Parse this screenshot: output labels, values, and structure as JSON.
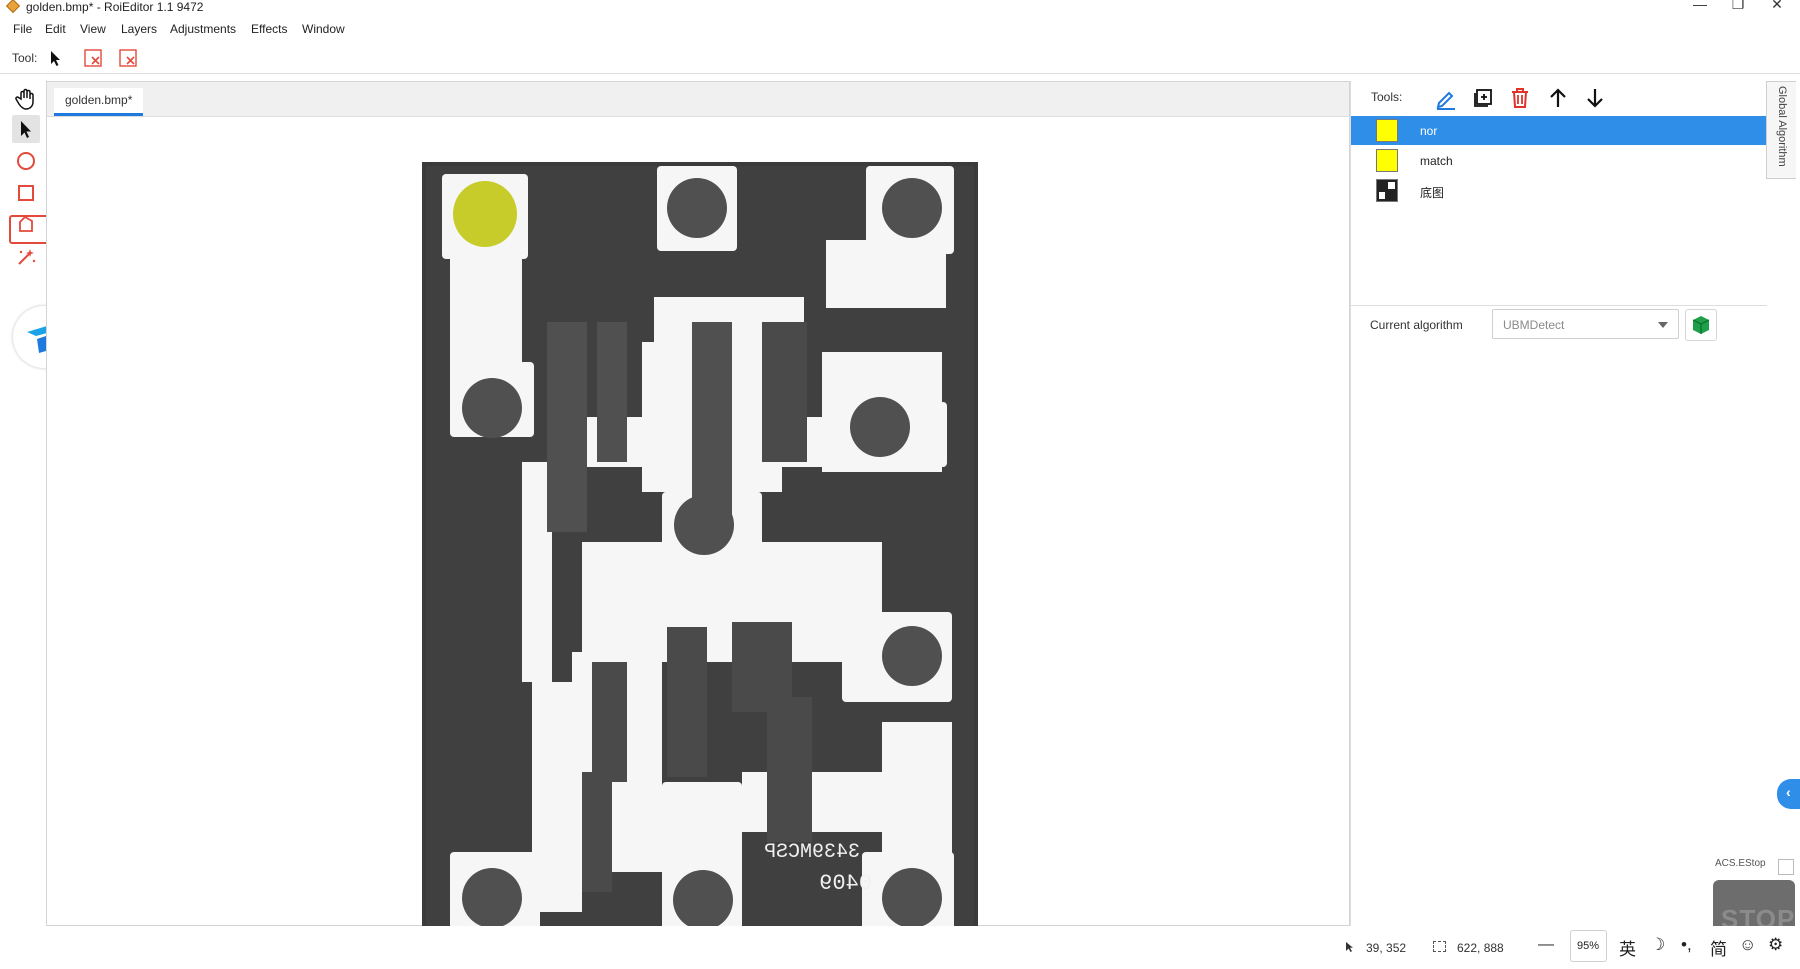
{
  "window": {
    "title": "golden.bmp* - RoiEditor 1.1 9472",
    "minimize": "—",
    "restore": "❐",
    "close": "✕"
  },
  "menu": [
    "File",
    "Edit",
    "View",
    "Layers",
    "Adjustments",
    "Effects",
    "Window"
  ],
  "toolbar": {
    "tool_label": "Tool:"
  },
  "tabs": {
    "document": "golden.bmp*"
  },
  "right_panel": {
    "tools_label": "Tools:",
    "layers": [
      {
        "name": "nor",
        "selected": true,
        "color": "#ffff00"
      },
      {
        "name": "match",
        "selected": false,
        "color": "#ffff00"
      },
      {
        "name": "底图",
        "selected": false,
        "color": "#222222"
      }
    ],
    "current_algorithm_label": "Current algorithm",
    "current_algorithm_value": "UBMDetect",
    "vertical_tab": "Global Algorithm"
  },
  "estop": {
    "label": "ACS.EStop",
    "text": "STOP"
  },
  "status": {
    "cursor_pos": "39, 352",
    "image_size": "622, 888",
    "zoom_out": "—",
    "zoom": "95%",
    "ime_lang": "英",
    "ime_moon": "☽",
    "ime_punct": "•,",
    "ime_simplified": "简",
    "ime_emoji": "☺",
    "ime_settings": "⚙"
  },
  "colors": {
    "accent": "#2f8fe8",
    "highlight_red": "#e34a3c",
    "trash_red": "#e0342b",
    "pen_blue": "#1f7adf",
    "cube_green": "#1ea04a",
    "roi_yellow": "#c7cc2a"
  }
}
